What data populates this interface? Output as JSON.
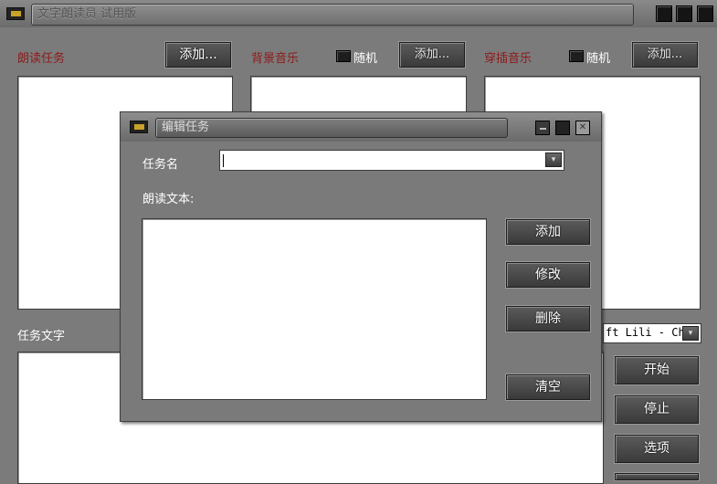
{
  "window": {
    "title": "文字朗读员 试用版",
    "icon": "app-monitor-icon",
    "controls": [
      "minimize",
      "maximize",
      "close"
    ]
  },
  "panels": {
    "reading_tasks": {
      "label": "朗读任务",
      "add_label": "添加..."
    },
    "bg_music": {
      "label": "背景音乐",
      "random_label": "随机",
      "add_label": "添加..."
    },
    "insert_music": {
      "label": "穿插音乐",
      "random_label": "随机",
      "add_label": "添加..."
    }
  },
  "task_text": {
    "label": "任务文字"
  },
  "voice_select": {
    "value": "ft Lili - Ch"
  },
  "side_buttons": {
    "start": "开始",
    "stop": "停止",
    "options": "选项"
  },
  "dialog": {
    "title": "编辑任务",
    "task_name_label": "任务名",
    "task_name_value": "",
    "reading_text_label": "朗读文本:",
    "buttons": {
      "add": "添加",
      "modify": "修改",
      "delete": "删除",
      "clear": "清空"
    }
  },
  "colors": {
    "background": "#7b7b7b",
    "section_label_red": "#8f1a1a",
    "button_dark": "#3a3a3a"
  }
}
